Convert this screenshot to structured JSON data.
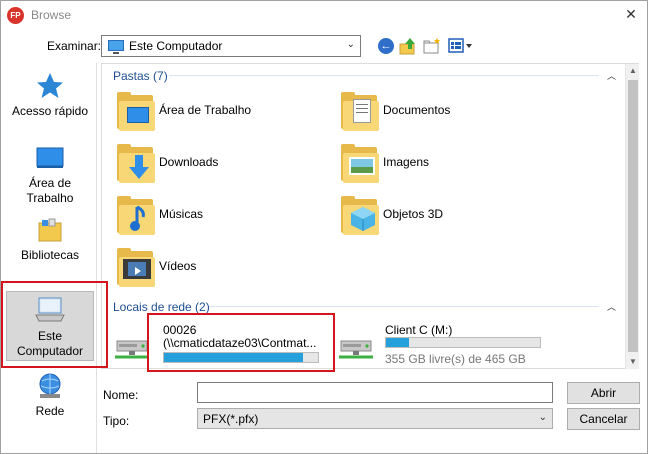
{
  "window": {
    "title": "Browse",
    "app_icon_text": "FP"
  },
  "lookin": {
    "label": "Examinar:",
    "value": "Este Computador"
  },
  "toolbar": {
    "icons": [
      "back-icon",
      "up-folder-icon",
      "new-folder-icon",
      "view-menu-icon"
    ]
  },
  "places": [
    {
      "label": "Acesso rápido",
      "icon": "star-icon"
    },
    {
      "label": "Área de Trabalho",
      "icon": "desktop-icon"
    },
    {
      "label": "Bibliotecas",
      "icon": "libraries-icon"
    },
    {
      "label": "Este Computador",
      "icon": "computer-icon",
      "selected": true
    },
    {
      "label": "Rede",
      "icon": "network-icon"
    }
  ],
  "groups": {
    "folders": {
      "header": "Pastas (7)"
    },
    "network": {
      "header": "Locais de rede (2)"
    }
  },
  "folders": [
    {
      "name": "Área de Trabalho",
      "icon": "desktop-folder-icon"
    },
    {
      "name": "Documentos",
      "icon": "documents-folder-icon"
    },
    {
      "name": "Downloads",
      "icon": "downloads-folder-icon"
    },
    {
      "name": "Imagens",
      "icon": "pictures-folder-icon"
    },
    {
      "name": "Músicas",
      "icon": "music-folder-icon"
    },
    {
      "name": "Objetos 3D",
      "icon": "3d-objects-folder-icon"
    },
    {
      "name": "Vídeos",
      "icon": "videos-folder-icon"
    }
  ],
  "network_locations": [
    {
      "name": "00026",
      "path": "(\\\\cmaticdataze03\\Contmat...",
      "usage_fraction": 0.9,
      "icon": "network-drive-icon"
    },
    {
      "name": "Client C (M:)",
      "free_text": "355 GB livre(s) de 465 GB",
      "usage_fraction": 0.15,
      "icon": "network-drive-icon"
    }
  ],
  "filename": {
    "label": "Nome:",
    "value": ""
  },
  "filetype": {
    "label": "Tipo:",
    "value": "PFX(*.pfx)"
  },
  "buttons": {
    "open": "Abrir",
    "cancel": "Cancelar"
  },
  "colors": {
    "accent": "#26a0da",
    "highlight": "#d5151e",
    "group_header": "#1e4e91"
  }
}
